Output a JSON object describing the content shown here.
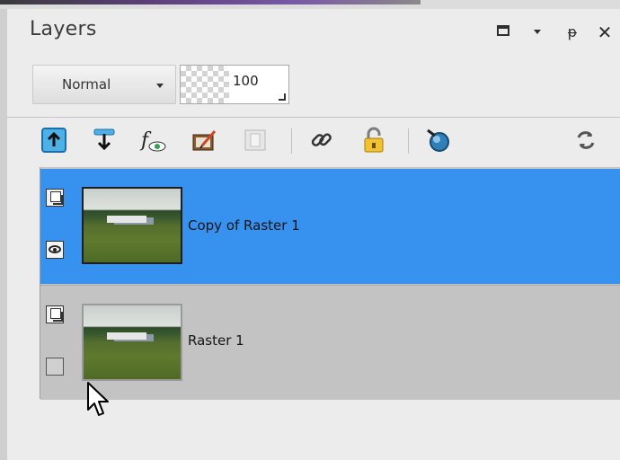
{
  "panel": {
    "title": "Layers",
    "window_buttons": [
      "maximize-icon",
      "dropdown-icon",
      "pin-icon",
      "close-icon"
    ],
    "pin_glyph": "ᵽ",
    "close_glyph": "✕"
  },
  "controls": {
    "blend_mode": "Normal",
    "opacity": "100"
  },
  "toolbar": {
    "icons": [
      "new-raster-layer-icon",
      "new-vector-layer-icon",
      "new-adjustment-layer-icon",
      "new-mask-layer-icon",
      "promote-layer-icon",
      "link-layers-icon",
      "lock-transparency-icon",
      "layer-styles-icon",
      "refresh-icon"
    ]
  },
  "layers": [
    {
      "name": "Copy of Raster 1",
      "selected": true,
      "visible": true
    },
    {
      "name": "Raster 1",
      "selected": false,
      "visible": false
    }
  ],
  "colors": {
    "selected_row": "#3691ef",
    "unselected_row": "#c3c3c3",
    "panel_bg": "#ececec"
  }
}
